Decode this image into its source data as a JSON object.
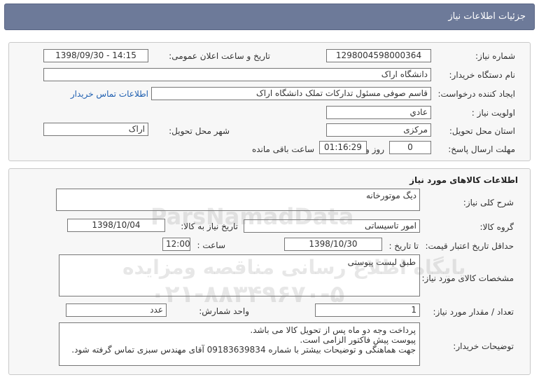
{
  "page": {
    "title": "جزئیات اطلاعات نیاز"
  },
  "general": {
    "need_number_label": "شماره نیاز:",
    "need_number": "1298004598000364",
    "announce_label": "تاریخ و ساعت اعلان عمومی:",
    "announce_value": "1398/09/30 - 14:15",
    "buyer_org_label": "نام دستگاه خریدار:",
    "buyer_org": "دانشگاه اراک",
    "creator_label": "ایجاد کننده درخواست:",
    "creator": "قاسم صوفی مسئول تدارکات تملک دانشگاه اراک",
    "contact_link": "اطلاعات تماس خریدار",
    "priority_label": "اولویت نیاز :",
    "priority": "عادي",
    "province_label": "استان محل تحویل:",
    "province": "مرکزی",
    "city_label": "شهر محل تحویل:",
    "city": "اراک",
    "deadline_label": "مهلت ارسال پاسخ:",
    "deadline_days": "0",
    "days_and_label": "روز و",
    "deadline_time": "01:16:29",
    "remaining_label": "ساعت باقی مانده"
  },
  "goods": {
    "section_title": "اطلاعات کالاهای مورد نیاز",
    "summary_label": "شرح کلی نیاز:",
    "summary": "دیگ موتورخانه",
    "group_label": "گروه کالا:",
    "group": "امور تاسیساتی",
    "need_date_label": "تاریخ نیاز به کالا:",
    "need_date": "1398/10/04",
    "min_validity_label": "حداقل تاریخ اعتبار قیمت:",
    "until_date_label": "تا تاریخ :",
    "until_date": "1398/10/30",
    "time_label": "ساعت :",
    "time_value": "12:00",
    "specs_label": "مشخصات کالای مورد نیاز:",
    "specs": "طبق لیست پیوستی",
    "quantity_label": "تعداد / مقدار مورد نیاز:",
    "quantity": "1",
    "unit_label": "واحد شمارش:",
    "unit": "عدد",
    "buyer_notes_label": "توضیحات خریدار:",
    "buyer_notes": [
      "پرداخت وجه دو ماه پس از تحویل کالا می باشد.",
      "پیوست پیش فاکتور الزامی است.",
      "جهت هماهنگی و توضیحات بیشتر با شماره 09183639834 آقای مهندس سبزی تماس گرفته شود."
    ]
  },
  "watermark": {
    "brand": "ParsNamadData",
    "line1": "پایگاه اطلاع رسانی مناقصه ومزایده",
    "phone": "۰۲۱-۸۸۳۴۹۶۷۰-۵"
  },
  "colors": {
    "title_bar": "#6d7a99",
    "panel_bg": "#f7f7f7",
    "link": "#1f5fb0"
  }
}
